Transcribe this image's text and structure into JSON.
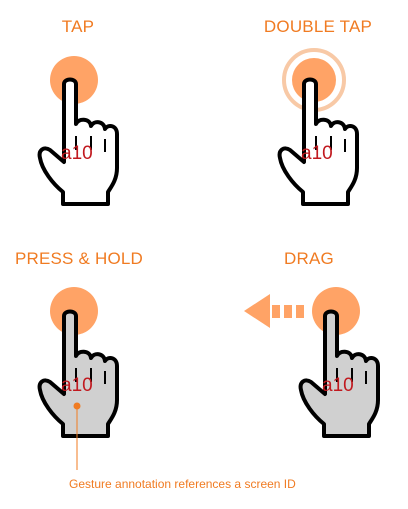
{
  "colors": {
    "accent": "#f07b22",
    "touch_circle": "#ffa366",
    "id_text": "#c1191f",
    "hand_fill_white": "#ffffff",
    "hand_fill_grey": "#d0d0d0",
    "outline": "#000000"
  },
  "gestures": [
    {
      "label": "TAP",
      "id": "a10",
      "icon": "tap-hand-icon"
    },
    {
      "label": "DOUBLE TAP",
      "id": "a10",
      "icon": "double-tap-hand-icon"
    },
    {
      "label": "PRESS & HOLD",
      "id": "a10",
      "icon": "press-hold-hand-icon"
    },
    {
      "label": "DRAG",
      "id": "a10",
      "icon": "drag-hand-icon"
    }
  ],
  "annotation": {
    "text": "Gesture annotation references a screen ID"
  }
}
